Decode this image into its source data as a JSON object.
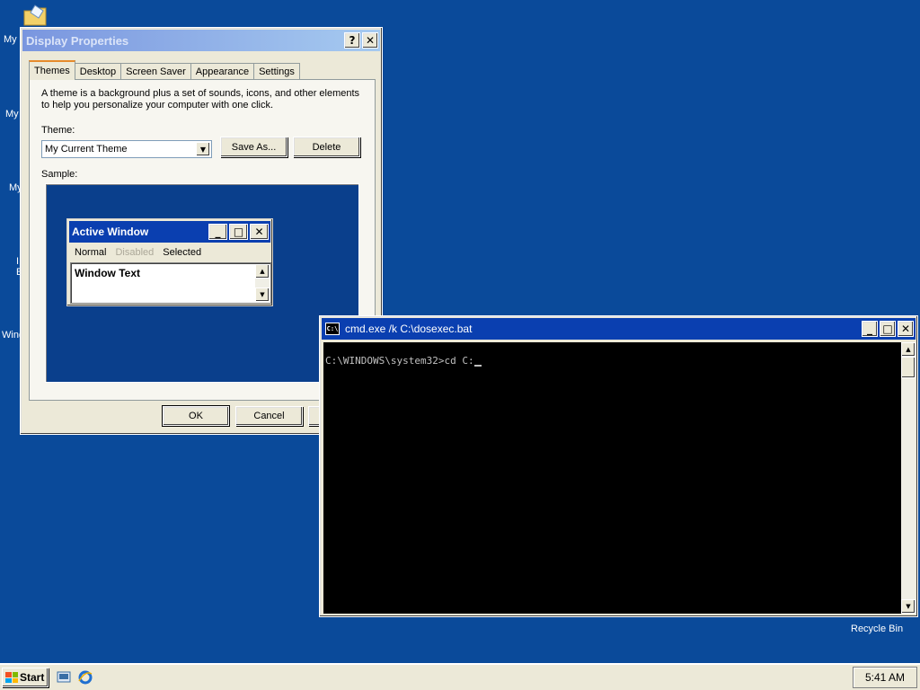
{
  "desktop": {
    "icons": [
      {
        "label": "My",
        "icon": "my-documents-folder-icon"
      },
      {
        "label": "My",
        "icon": "my-computer-icon"
      },
      {
        "label": "My",
        "icon": "my-network-icon"
      },
      {
        "label": "I",
        "icon": "internet-explorer-icon"
      },
      {
        "label": "E",
        "icon": "internet-explorer-icon"
      },
      {
        "label": "Wind",
        "icon": "windows-media-icon"
      }
    ],
    "recycle_bin_label": "Recycle Bin"
  },
  "display_properties": {
    "title": "Display Properties",
    "help_btn": "?",
    "close_btn": "✕",
    "tabs": [
      {
        "label": "Themes",
        "selected": true
      },
      {
        "label": "Desktop",
        "selected": false
      },
      {
        "label": "Screen Saver",
        "selected": false
      },
      {
        "label": "Appearance",
        "selected": false
      },
      {
        "label": "Settings",
        "selected": false
      }
    ],
    "description_line1": "A theme is a background plus a set of sounds, icons, and other elements",
    "description_line2": "to help you personalize your computer with one click.",
    "theme_label": "Theme:",
    "theme_value": "My Current Theme",
    "save_as_label": "Save As...",
    "delete_label": "Delete",
    "sample_label": "Sample:",
    "sample_window": {
      "title": "Active Window",
      "menu_normal": "Normal",
      "menu_disabled": "Disabled",
      "menu_selected": "Selected",
      "text": "Window Text"
    },
    "ok_label": "OK",
    "cancel_label": "Cancel"
  },
  "cmd_window": {
    "title": "cmd.exe /k C:\\dosexec.bat",
    "icon_text": "C:\\",
    "prompt": "C:\\WINDOWS\\system32>cd C:"
  },
  "taskbar": {
    "start_label": "Start",
    "quick_launch": [
      "show-desktop-icon",
      "internet-explorer-icon"
    ],
    "clock": "5:41 AM"
  },
  "colors": {
    "desktop_bg": "#0a4a9a",
    "active_title": "#0a3fb0",
    "inactive_title": "#7a96df",
    "window_face": "#ece9d8",
    "console_bg": "#000000",
    "console_text": "#c0c0c0"
  }
}
